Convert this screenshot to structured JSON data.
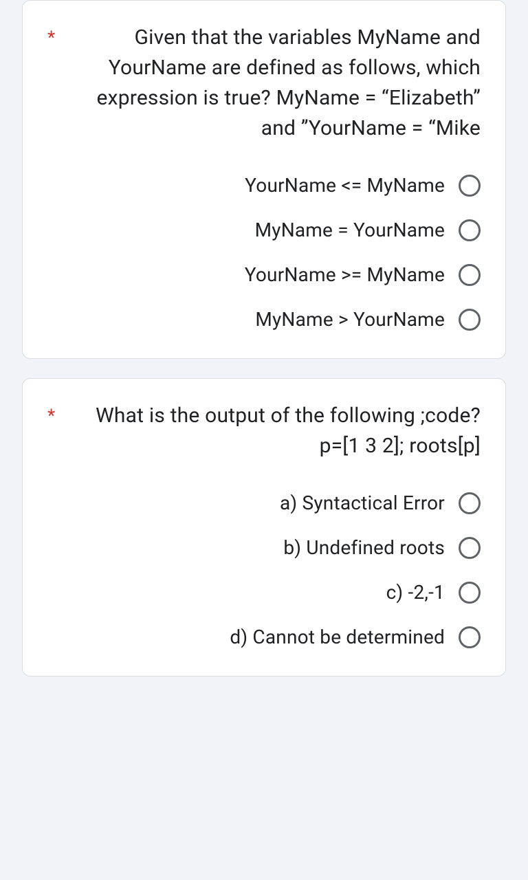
{
  "questions": [
    {
      "required_marker": "*",
      "text": "Given that the variables MyName and YourName are defined as follows, which expression is true? MyName = “Elizabeth” and ”YourName = “Mike",
      "options": [
        "YourName <= MyName",
        "MyName = YourName",
        "YourName >= MyName",
        "MyName > YourName"
      ]
    },
    {
      "required_marker": "*",
      "text": "What is the output of the following ;code? p=[1 3 2]; roots[p]",
      "options": [
        "a) Syntactical Error",
        "b) Undefined roots",
        "c) -2,-1",
        "d) Cannot be determined"
      ]
    }
  ]
}
